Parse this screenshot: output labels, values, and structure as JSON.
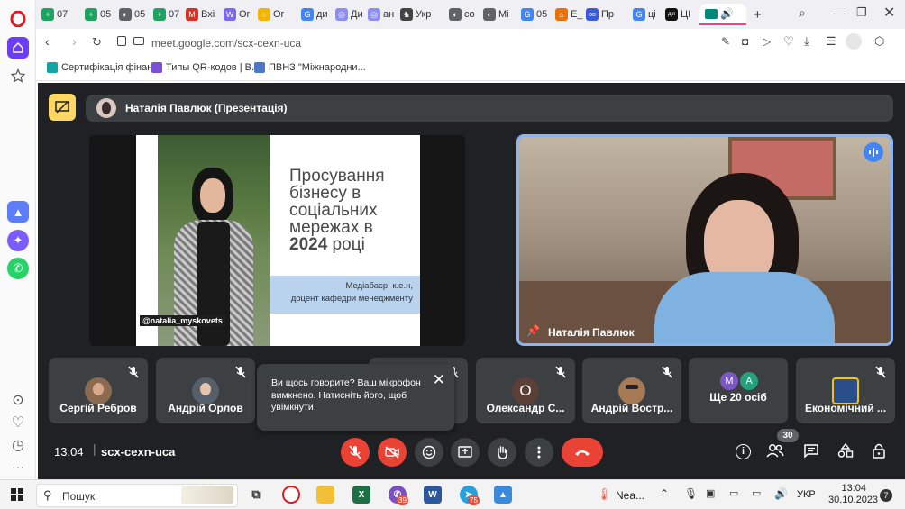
{
  "browser": {
    "tabs": [
      {
        "label": "07",
        "color": "#1ea362",
        "glyph": "+"
      },
      {
        "label": "05",
        "color": "#1ea362",
        "glyph": "+"
      },
      {
        "label": "05",
        "color": "#5f6368",
        "glyph": "◐"
      },
      {
        "label": "07",
        "color": "#1ea362",
        "glyph": "+"
      },
      {
        "label": "Вхі",
        "color": "#d93025",
        "glyph": "M"
      },
      {
        "label": "Or",
        "color": "#7b68ee",
        "glyph": "W"
      },
      {
        "label": "Or",
        "color": "#f5b400",
        "glyph": "○"
      },
      {
        "label": "ди",
        "color": "#4285f4",
        "glyph": "G"
      },
      {
        "label": "Ди",
        "color": "#8e8ef0",
        "glyph": "◎"
      },
      {
        "label": "ан",
        "color": "#8e8ef0",
        "glyph": "◎"
      },
      {
        "label": "Укр",
        "color": "#444",
        "glyph": "♞"
      },
      {
        "label": "co",
        "color": "#5f6368",
        "glyph": "◐"
      },
      {
        "label": "Мі",
        "color": "#5f6368",
        "glyph": "◐"
      },
      {
        "label": "05",
        "color": "#4285f4",
        "glyph": "G"
      },
      {
        "label": "E_",
        "color": "#e8710a",
        "glyph": "⌂"
      },
      {
        "label": "Пр",
        "color": "#3b5bdb",
        "glyph": "oo"
      },
      {
        "label": "ці",
        "color": "#4285f4",
        "glyph": "G"
      },
      {
        "label": "ЦІ",
        "color": "#111",
        "glyph": "дія"
      }
    ],
    "url": "meet.google.com/scx-cexn-uca",
    "bookmarks": [
      {
        "label": "Сертифікація фінан...",
        "color": "#14a3a3"
      },
      {
        "label": "Типы QR-кодов | В...",
        "color": "#7b4fd6"
      },
      {
        "label": "ПВНЗ \"Міжнародни...",
        "color": "#4b79c7"
      }
    ]
  },
  "meet": {
    "presenter_bar": "Наталія Павлюк (Презентація)",
    "slide": {
      "title": "Просування бізнесу в соціальних мережах в 2024 році",
      "title_lines": [
        "Просування",
        "бізнесу в",
        "соціальних",
        "мережах в"
      ],
      "title_year": "2024",
      "title_last": " році",
      "subtitle_line1": "Медіабаєр, к.е.н,",
      "subtitle_line2": "доцент кафедри менеджменту",
      "handle": "@natalia_myskovets"
    },
    "speaker_name": "Наталія Павлюк",
    "participants": [
      {
        "name": "Сергій Ребров",
        "initial": "",
        "color": "#8b6a4f"
      },
      {
        "name": "Андрій Орлов",
        "initial": "",
        "color": "#55606b"
      },
      {
        "name": "",
        "initial": "",
        "color": "#3c4043"
      },
      {
        "name": "Олександр С...",
        "initial": "О",
        "color": "#5b4037"
      },
      {
        "name": "Андрій Востр...",
        "initial": "",
        "color": "#a57a55"
      },
      {
        "name": "Ще 20 осіб",
        "initial": "",
        "color": "#3c4043"
      },
      {
        "name": "Економічний ...",
        "initial": "",
        "color": "#2a4e8a"
      }
    ],
    "more_avatars": [
      "М",
      "А"
    ],
    "tooltip": "Ви щось говорите? Ваш мікрофон вимкнено. Натисніть його, щоб увімкнути.",
    "time": "13:04",
    "meeting_code": "scx-cexn-uca",
    "participants_count": "30"
  },
  "taskbar": {
    "search_placeholder": "Пошук",
    "weather": "Nea...",
    "lang": "УКР",
    "clock_time": "13:04",
    "clock_date": "30.10.2023",
    "badge_viber": "39",
    "badge_telegram": "75",
    "badge_notif": "7"
  },
  "colors": {
    "meet_bg": "#202124",
    "tile_bg": "#3c4043",
    "end_call": "#ea4335",
    "speaking_border": "#8ab4f8",
    "slide_accent": "#b9d3ee"
  }
}
